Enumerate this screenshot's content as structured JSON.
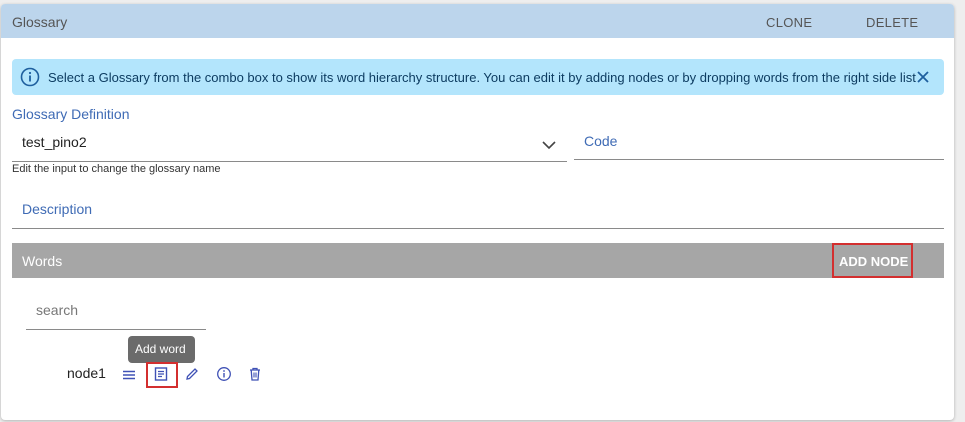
{
  "header": {
    "title": "Glossary",
    "clone_label": "CLONE",
    "delete_label": "DELETE"
  },
  "info_banner": {
    "text": "Select a Glossary from the combo box to show its word hierarchy structure. You can edit it by adding nodes or by dropping words from the right side list"
  },
  "form": {
    "glossary_definition_label": "Glossary Definition",
    "glossary_definition_value": "test_pino2",
    "glossary_helper": "Edit the input to change the glossary name",
    "code_placeholder": "Code",
    "description_placeholder": "Description"
  },
  "words": {
    "title": "Words",
    "add_node_label": "ADD NODE",
    "search_placeholder": "search",
    "tooltip": "Add word",
    "nodes": [
      {
        "label": "node1",
        "actions": [
          "menu-icon",
          "add-word-icon",
          "edit-icon",
          "info-icon",
          "delete-icon"
        ]
      }
    ]
  },
  "colors": {
    "header_bg": "#bcd5ec",
    "info_bg": "#b3e5fc",
    "accent": "#3f6bb5",
    "words_bar_bg": "#a6a6a6",
    "highlight": "#d32f2f"
  }
}
